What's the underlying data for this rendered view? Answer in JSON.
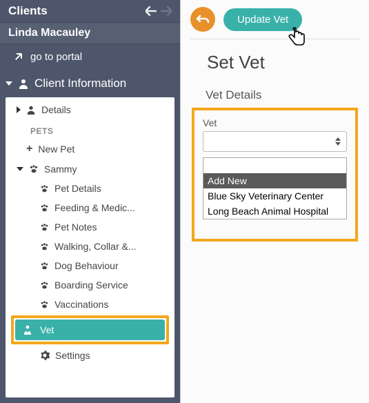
{
  "sidebar": {
    "title": "Clients",
    "client_name": "Linda Macauley",
    "portal_link": "go to portal",
    "section": "Client Information",
    "details": "Details",
    "pets_label": "PETS",
    "new_pet": "New Pet",
    "pet_name": "Sammy",
    "items": {
      "pet_details": "Pet Details",
      "feeding": "Feeding & Medic...",
      "notes": "Pet Notes",
      "walking": "Walking, Collar &...",
      "behaviour": "Dog Behaviour",
      "boarding": "Boarding Service",
      "vaccinations": "Vaccinations",
      "vet": "Vet",
      "settings": "Settings"
    }
  },
  "main": {
    "update_button": "Update Vet",
    "title": "Set Vet",
    "section": "Vet Details",
    "field_label": "Vet",
    "options": {
      "add_new": "Add New",
      "opt1": "Blue Sky Veterinary Center",
      "opt2": "Long Beach Animal Hospital"
    }
  }
}
